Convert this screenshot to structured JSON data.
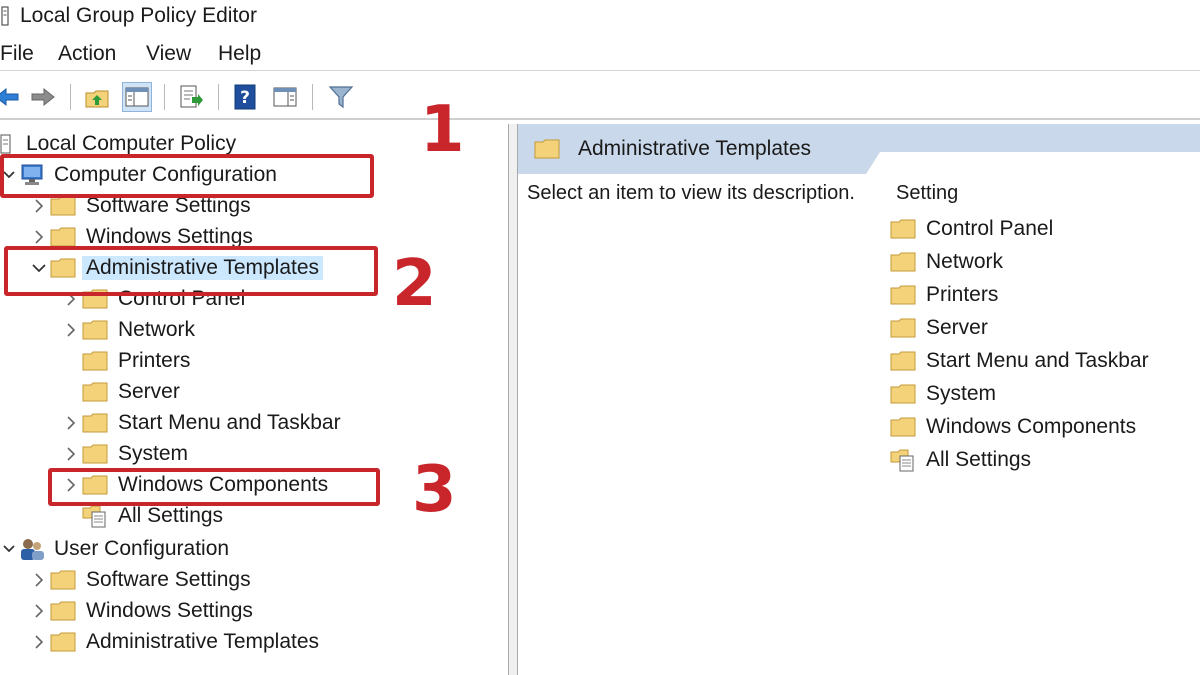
{
  "window": {
    "title": "Local Group Policy Editor"
  },
  "menu": [
    {
      "label": "File"
    },
    {
      "label": "Action"
    },
    {
      "label": "View"
    },
    {
      "label": "Help"
    }
  ],
  "toolbar": {
    "buttons": [
      "back-arrow-icon",
      "forward-arrow-icon",
      "up-folder-icon",
      "show-hide-tree-icon",
      "export-list-icon",
      "help-icon",
      "properties-view-icon",
      "filter-icon"
    ]
  },
  "tree": {
    "root": "Local Computer Policy",
    "computer_configuration": "Computer Configuration",
    "cc_software_settings": "Software Settings",
    "cc_windows_settings": "Windows Settings",
    "cc_admin_templates": "Administrative Templates",
    "at_children": [
      "Control Panel",
      "Network",
      "Printers",
      "Server",
      "Start Menu and Taskbar",
      "System",
      "Windows Components",
      "All Settings"
    ],
    "user_configuration": "User Configuration",
    "uc_software_settings": "Software Settings",
    "uc_windows_settings": "Windows Settings",
    "uc_admin_templates": "Administrative Templates"
  },
  "details": {
    "header": "Administrative Templates",
    "description": "Select an item to view its description.",
    "column_header": "Setting",
    "items": [
      "Control Panel",
      "Network",
      "Printers",
      "Server",
      "Start Menu and Taskbar",
      "System",
      "Windows Components",
      "All Settings"
    ]
  },
  "annotations": {
    "n1": "1",
    "n2": "2",
    "n3": "3"
  },
  "colors": {
    "annotation_red": "#c9262c",
    "selection": "#cce8ff",
    "header_bar": "#c9d8ea",
    "folder": "#f3d27a"
  }
}
